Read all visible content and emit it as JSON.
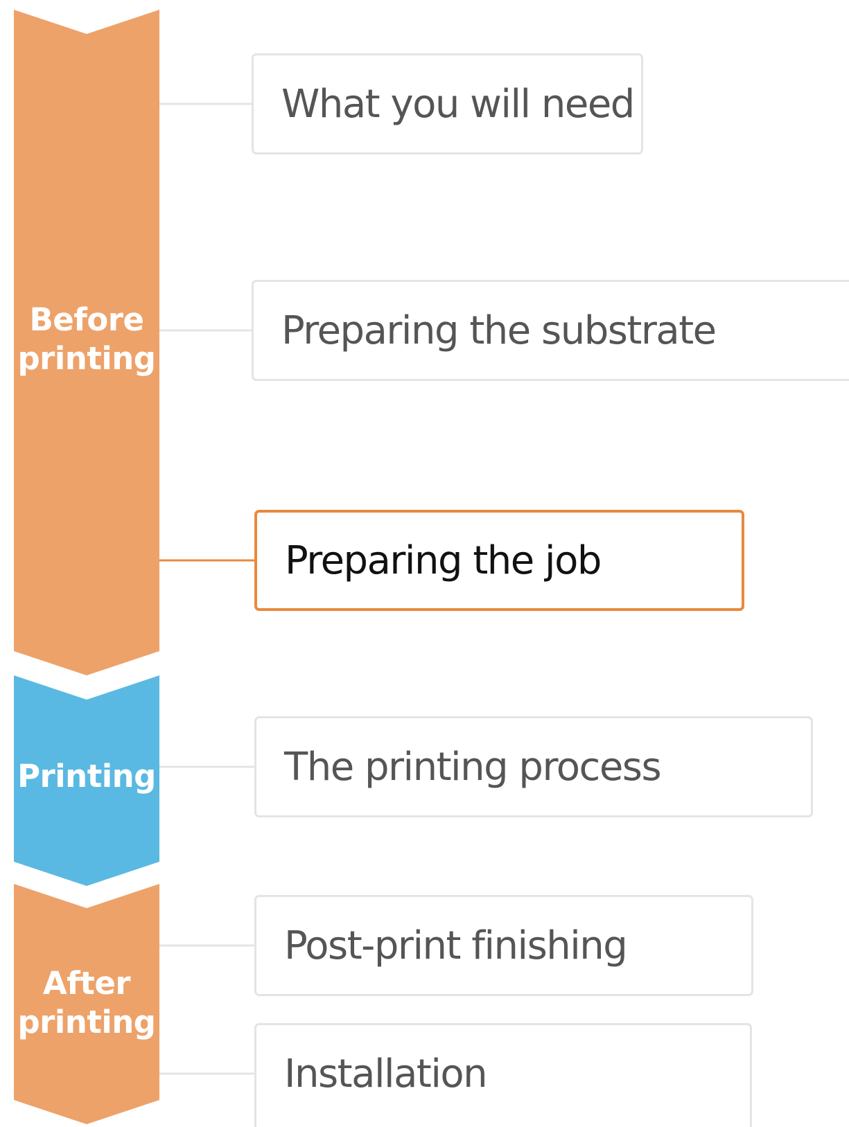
{
  "colors": {
    "before_printing": "#eda26a",
    "printing": "#5ab9e2",
    "after_printing": "#eda26a",
    "connector": "#e4e4e4",
    "active_accent": "#e8893e"
  },
  "stages": [
    {
      "id": "before",
      "label_lines": [
        "Before",
        "printing"
      ]
    },
    {
      "id": "printing",
      "label_lines": [
        "Printing"
      ]
    },
    {
      "id": "after",
      "label_lines": [
        "After",
        "printing"
      ]
    }
  ],
  "steps": [
    {
      "label": "What you will need",
      "stage": "before",
      "active": false
    },
    {
      "label": "Preparing the substrate",
      "stage": "before",
      "active": false
    },
    {
      "label": "Preparing the job",
      "stage": "before",
      "active": true
    },
    {
      "label": "The printing process",
      "stage": "printing",
      "active": false
    },
    {
      "label": "Post-print finishing",
      "stage": "after",
      "active": false
    },
    {
      "label": "Installation",
      "stage": "after",
      "active": false
    }
  ]
}
